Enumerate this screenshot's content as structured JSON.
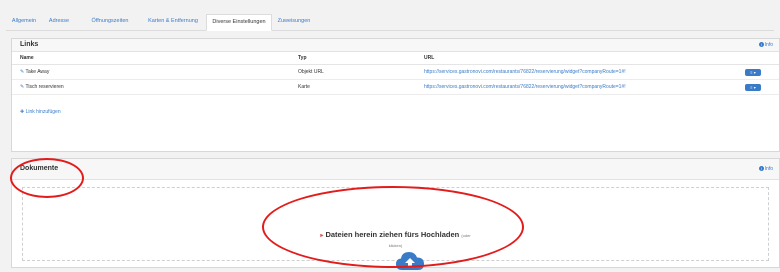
{
  "tabs": [
    {
      "label": "Allgemein",
      "active": false
    },
    {
      "label": "Adresse",
      "active": false
    },
    {
      "label": "Öffnungszeiten",
      "active": false
    },
    {
      "label": "Karten & Entfernung",
      "active": false
    },
    {
      "label": "Diverse Einstellungen",
      "active": true
    },
    {
      "label": "Zuweisungen",
      "active": false
    }
  ],
  "links_panel": {
    "title": "Links",
    "info": "Info",
    "columns": {
      "name": "Name",
      "type": "Typ",
      "url": "URL"
    },
    "rows": [
      {
        "name": "Take Away",
        "type": "Objekt URL",
        "url": "https://services.gastronovi.com/restaurants/76822/reservierung/widget?companyRoute=1#!"
      },
      {
        "name": "Tisch reservieren",
        "type": "Karte",
        "url": "https://services.gastronovi.com/restaurants/76822/reservierung/widget?companyRoute=1#!"
      }
    ],
    "add_label": "Link hinzufügen"
  },
  "docs_panel": {
    "title": "Dokumente",
    "info": "Info",
    "drop_text": "Dateien herein ziehen fürs Hochladen",
    "drop_or": "(oder",
    "drop_click": "klicken)"
  },
  "colors": {
    "accent": "#3a7bc8",
    "annotation": "#e31b1b"
  }
}
